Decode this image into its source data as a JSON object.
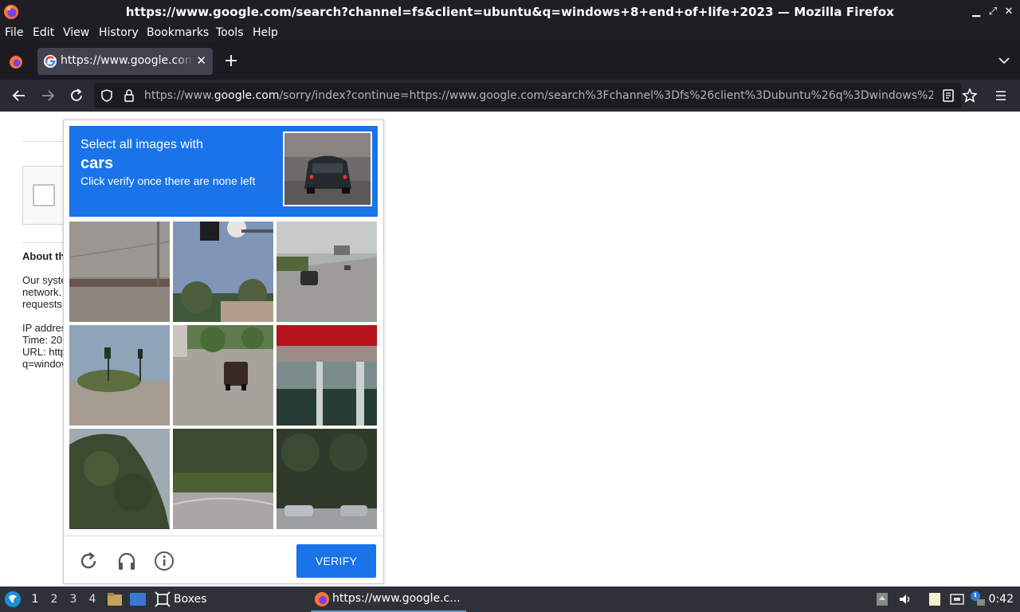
{
  "window": {
    "title": "https://www.google.com/search?channel=fs&client=ubuntu&q=windows+8+end+of+life+2023 — Mozilla Firefox"
  },
  "menubar": {
    "items": [
      "File",
      "Edit",
      "View",
      "History",
      "Bookmarks",
      "Tools",
      "Help"
    ]
  },
  "tabs": [
    {
      "label": "https://www.google.com/sorry/index?continue"
    }
  ],
  "navbar": {
    "url_prefix": "https://www.",
    "url_host": "google.com",
    "url_rest": "/sorry/index?continue=https://www.google.com/search%3Fchannel%3Dfs%26client%3Dubuntu%26q%3Dwindows%2"
  },
  "page": {
    "about_heading": "About th",
    "body_lines": [
      "Our syste",
      "network.",
      "requests"
    ],
    "info_lines": [
      "IP addres",
      "Time: 20",
      "URL: http",
      "q=windov"
    ]
  },
  "captcha": {
    "instruction_line1": "Select all images with",
    "target": "cars",
    "instruction_line3": "Click verify once there are none left",
    "verify_label": "VERIFY",
    "tiles": [
      {
        "id": 1,
        "desc": "overpass"
      },
      {
        "id": 2,
        "desc": "traffic light"
      },
      {
        "id": 3,
        "desc": "highway car"
      },
      {
        "id": 4,
        "desc": "traffic lights"
      },
      {
        "id": 5,
        "desc": "jeep"
      },
      {
        "id": 6,
        "desc": "station canopy"
      },
      {
        "id": 7,
        "desc": "tree"
      },
      {
        "id": 8,
        "desc": "hedge road"
      },
      {
        "id": 9,
        "desc": "trees cars"
      }
    ]
  },
  "taskbar": {
    "workspaces": [
      "1",
      "2",
      "3",
      "4"
    ],
    "active_workspace": "1",
    "boxes_label": "Boxes",
    "task_label": "https://www.google.c...",
    "clock": "0:42"
  },
  "colors": {
    "captcha_blue": "#1a73e8",
    "titlebar": "#1f1e25",
    "tabstrip": "#1c1b22",
    "navbar": "#2b2a33",
    "taskbar": "#2e3238"
  }
}
